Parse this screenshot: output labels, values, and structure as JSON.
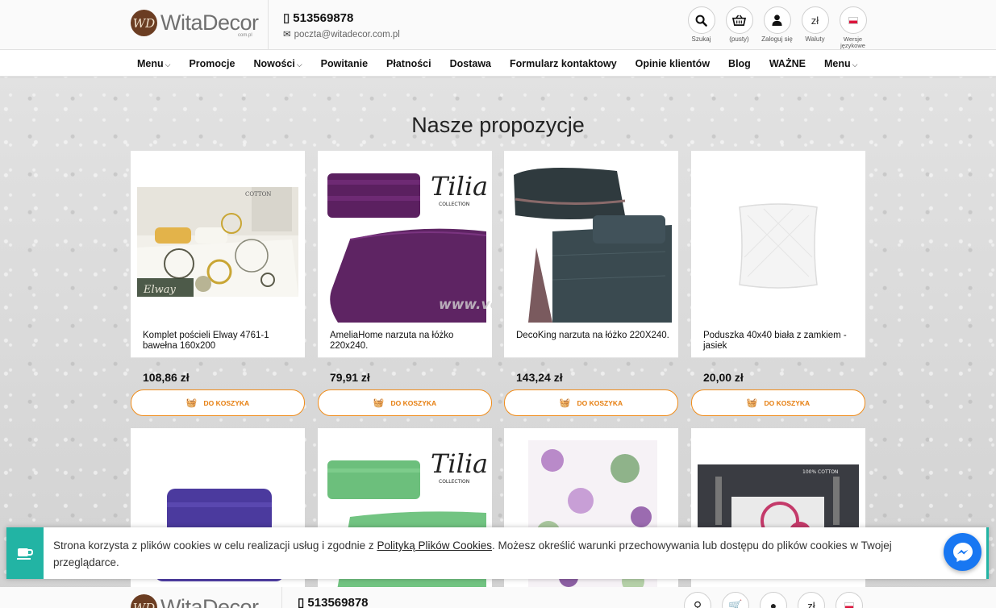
{
  "header": {
    "logo_text": "WitaDecor",
    "logo_mark": "WD",
    "logo_sub": "com.pl",
    "phone": "513569878",
    "email": "poczta@witadecor.com.pl",
    "icons": [
      {
        "name": "search-icon",
        "glyph": "⚲",
        "label": "Szukaj"
      },
      {
        "name": "basket-icon",
        "glyph": "🛒",
        "label": "(pusty)"
      },
      {
        "name": "user-icon",
        "glyph": "👤",
        "label": "Zaloguj się"
      },
      {
        "name": "currency-icon",
        "glyph": "zł",
        "label": "Waluty"
      },
      {
        "name": "language-flag-icon",
        "glyph": "",
        "label": "Wersje językowe"
      }
    ]
  },
  "nav": {
    "items": [
      {
        "label": "Menu",
        "dropdown": true
      },
      {
        "label": "Promocje",
        "dropdown": false
      },
      {
        "label": "Nowości",
        "dropdown": true
      },
      {
        "label": "Powitanie",
        "dropdown": false
      },
      {
        "label": "Płatności",
        "dropdown": false
      },
      {
        "label": "Dostawa",
        "dropdown": false
      },
      {
        "label": "Formularz kontaktowy",
        "dropdown": false
      },
      {
        "label": "Opinie klientów",
        "dropdown": false
      },
      {
        "label": "Blog",
        "dropdown": false
      },
      {
        "label": "WAŻNE",
        "dropdown": false
      },
      {
        "label": "Menu",
        "dropdown": true
      }
    ]
  },
  "section": {
    "title": "Nasze propozycje"
  },
  "cart_button_label": "Do koszyka",
  "products_row1": [
    {
      "name": "Komplet pościeli Elway 4761-1 bawełna 160x200",
      "price": "108,86 zł",
      "image": "bedding-elway"
    },
    {
      "name": "AmeliaHome narzuta na łóżko 220x240.",
      "price": "79,91 zł",
      "image": "tilia-purple"
    },
    {
      "name": "DecoKing narzuta na łóżko 220X240.",
      "price": "143,24 zł",
      "image": "decoking-dark"
    },
    {
      "name": "Poduszka 40x40 biała z zamkiem - jasiek",
      "price": "20,00 zł",
      "image": "pillow-white"
    }
  ],
  "products_row2": [
    {
      "image": "towels-purple"
    },
    {
      "image": "tilia-green"
    },
    {
      "image": "floral-bedding"
    },
    {
      "image": "bedroom-dark"
    }
  ],
  "image_text": {
    "tilia": "Tilia",
    "collection": "COLLECTION",
    "cotton": "COTTON",
    "cotton100": "100% COTTON",
    "elway": "Elway",
    "watermark": "www.volpoint.pl"
  },
  "cookie": {
    "text_before": "Strona korzysta z plików cookies w celu realizacji usług i zgodnie z ",
    "link": "Polityką Plików Cookies",
    "text_after": ". Możesz określić warunki przechowywania lub dostępu do plików cookies w Twojej przeglądarce."
  },
  "colors": {
    "accent": "#f08c1a",
    "cookie_teal": "#22b4a4",
    "messenger": "#1877f2"
  }
}
